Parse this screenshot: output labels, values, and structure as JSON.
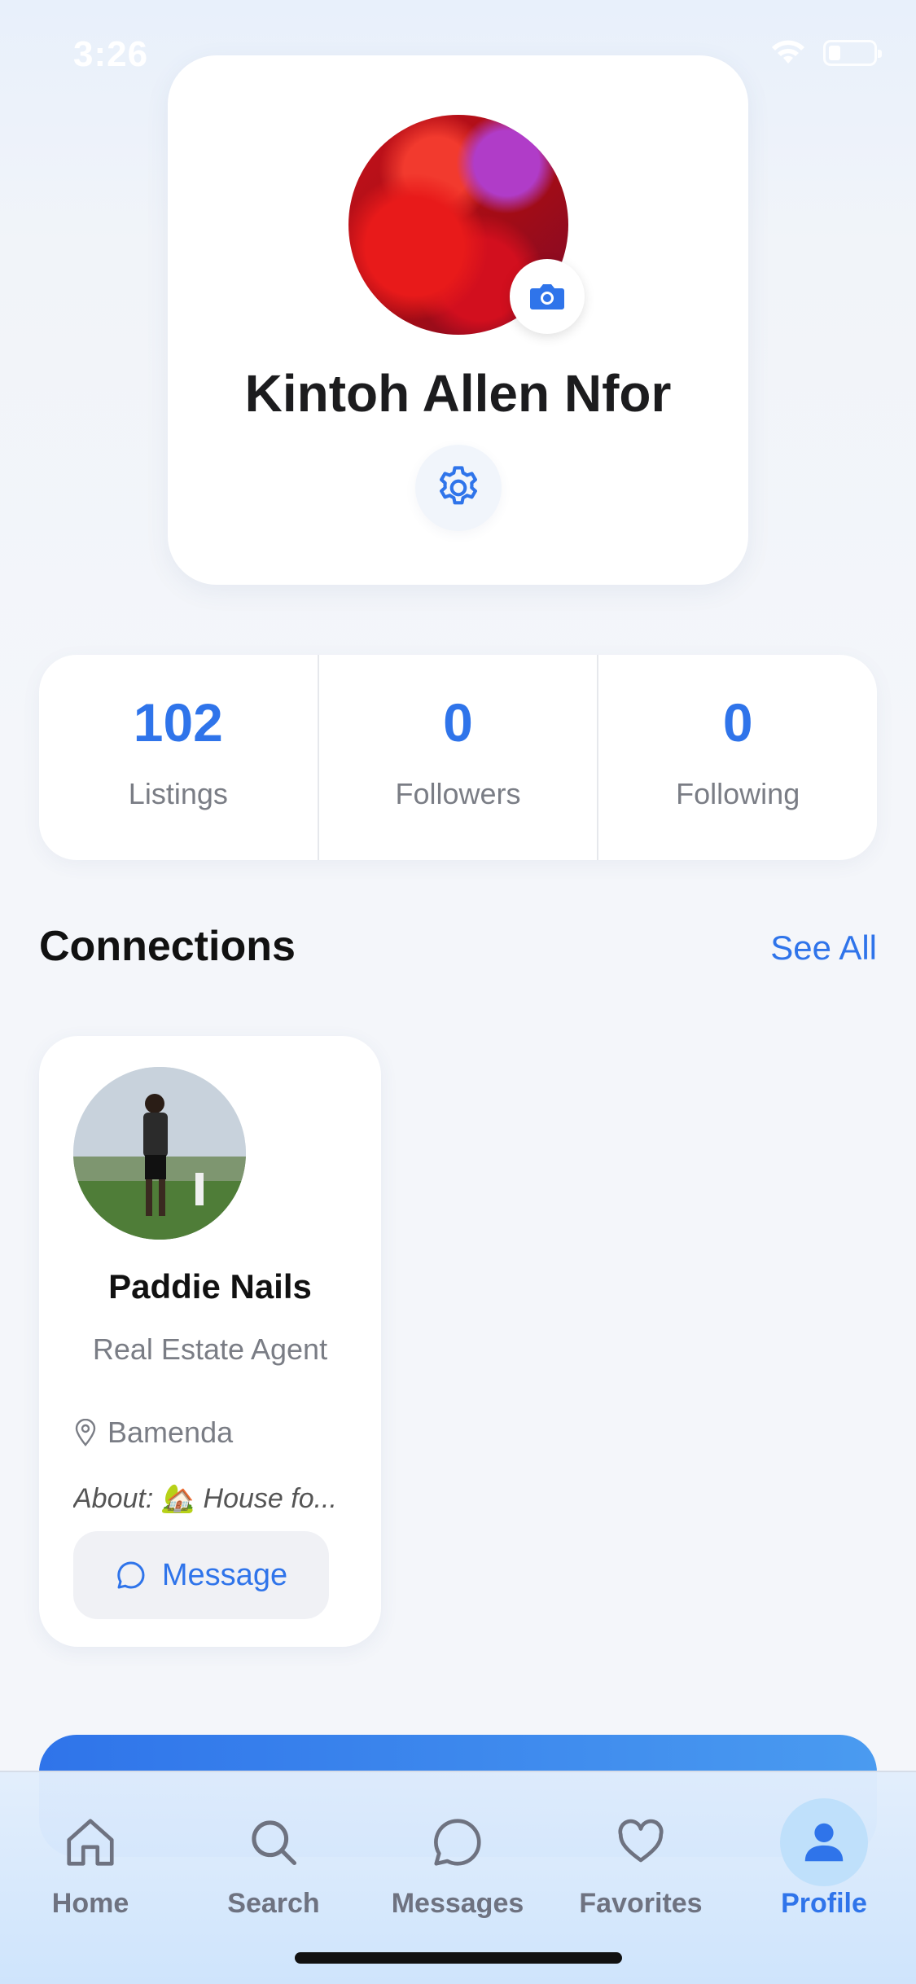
{
  "status_bar": {
    "time": "3:26"
  },
  "profile": {
    "name": "Kintoh Allen Nfor",
    "avatar_icon": "flower-photo-avatar"
  },
  "stats": [
    {
      "value": "102",
      "label": "Listings"
    },
    {
      "value": "0",
      "label": "Followers"
    },
    {
      "value": "0",
      "label": "Following"
    }
  ],
  "connections": {
    "title": "Connections",
    "see_all_label": "See All",
    "items": [
      {
        "name": "Paddie Nails",
        "role": "Real Estate Agent",
        "location": "Bamenda",
        "about": "About: 🏡 House fo...",
        "message_label": "Message"
      }
    ]
  },
  "tabbar": {
    "items": [
      {
        "label": "Home",
        "icon": "home-icon",
        "active": false
      },
      {
        "label": "Search",
        "icon": "search-icon",
        "active": false
      },
      {
        "label": "Messages",
        "icon": "chat-icon",
        "active": false
      },
      {
        "label": "Favorites",
        "icon": "heart-icon",
        "active": false
      },
      {
        "label": "Profile",
        "icon": "person-icon",
        "active": true
      }
    ]
  },
  "colors": {
    "accent": "#2f74ea",
    "text_secondary": "#7a7d85",
    "tab_inactive": "#6e7280"
  }
}
